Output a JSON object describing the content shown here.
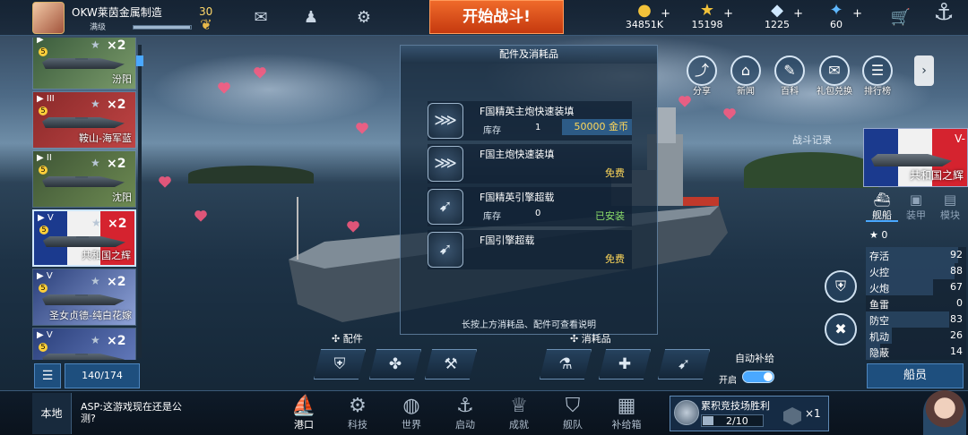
{
  "player": {
    "name": "OKW莱茵金属制造",
    "rank": "满级",
    "level": "30",
    "xp_fraction": 0.98
  },
  "start_battle": "开始战斗!",
  "resources": [
    {
      "icon": "gold-coin-icon",
      "symbol": "●",
      "value": "34851K",
      "color": "#f2c23a"
    },
    {
      "icon": "star-icon",
      "symbol": "★",
      "value": "15198",
      "color": "#f2c23a"
    },
    {
      "icon": "diamond-icon",
      "symbol": "◆",
      "value": "1225",
      "color": "#cfe8ff"
    },
    {
      "icon": "gem-icon",
      "symbol": "✦",
      "value": "60",
      "color": "#5fb8ff"
    }
  ],
  "fleet": [
    {
      "name": "汾阳",
      "tier": "",
      "mult": "×2",
      "bg": "linear-gradient(135deg,#3a5b3c,#7a9a6a)"
    },
    {
      "name": "鞍山-海军蓝",
      "tier": "III",
      "mult": "×2",
      "bg": "linear-gradient(135deg,#8a2a2a,#c04444)"
    },
    {
      "name": "沈阳",
      "tier": "II",
      "mult": "×2",
      "bg": "linear-gradient(135deg,#3f5636,#6d8a52)"
    },
    {
      "name": "共和国之辉",
      "tier": "V",
      "mult": "×2",
      "bg": "linear-gradient(90deg,#1b3a8e 0 33%,#f1f1f1 33% 66%,#d5232f 66%)"
    },
    {
      "name": "圣女贞德-纯白花嫁",
      "tier": "V",
      "mult": "×2",
      "bg": "linear-gradient(135deg,#2a3f7a,#8fa3d8)"
    },
    {
      "name": "",
      "tier": "V",
      "mult": "×2",
      "bg": "linear-gradient(135deg,#2a3f7a,#6b82c4)"
    }
  ],
  "fleet_count": "140/174",
  "top_menu": [
    {
      "label": "分享",
      "icon": "share-icon",
      "symbol": "⤴"
    },
    {
      "label": "新闻",
      "icon": "news-icon",
      "symbol": "⌂"
    },
    {
      "label": "百科",
      "icon": "encyclopedia-icon",
      "symbol": "✎"
    },
    {
      "label": "礼包兑换",
      "icon": "gift-icon",
      "symbol": "✉"
    },
    {
      "label": "排行榜",
      "icon": "ranking-icon",
      "symbol": "☰"
    }
  ],
  "battle_log": "战斗记录",
  "ship_card": {
    "name": "共和国之辉",
    "tier": "V-"
  },
  "right_tabs": [
    {
      "label": "舰船",
      "icon": "ship-icon",
      "symbol": "⛴"
    },
    {
      "label": "装甲",
      "icon": "armor-icon",
      "symbol": "▣"
    },
    {
      "label": "模块",
      "icon": "module-icon",
      "symbol": "▤"
    }
  ],
  "stars_count": "0",
  "stats": [
    {
      "name": "存活",
      "value": 92
    },
    {
      "name": "火控",
      "value": 88
    },
    {
      "name": "火炮",
      "value": 67
    },
    {
      "name": "鱼雷",
      "value": 0
    },
    {
      "name": "防空",
      "value": 83
    },
    {
      "name": "机动",
      "value": 26
    },
    {
      "name": "隐蔽",
      "value": 14
    }
  ],
  "crew_button": "船员",
  "modal": {
    "title": "配件及消耗品",
    "stock_label": "库存",
    "items": [
      {
        "name": "F国精英主炮快速装填",
        "qty": "1",
        "price": "50000 金币",
        "status": "",
        "icon": "reload-elite-icon",
        "symbol": "⋙"
      },
      {
        "name": "F国主炮快速装填",
        "qty": "",
        "price": "",
        "status": "免费",
        "icon": "reload-icon",
        "symbol": "⋙"
      },
      {
        "name": "F国精英引擎超载",
        "qty": "0",
        "price": "",
        "status": "已安装",
        "icon": "engine-elite-icon",
        "symbol": "➹"
      },
      {
        "name": "F国引擎超载",
        "qty": "",
        "price": "",
        "status": "免费",
        "icon": "engine-icon",
        "symbol": "➹"
      }
    ],
    "hint": "长按上方消耗品、配件可查看说明"
  },
  "slots": {
    "parts_label": "配件",
    "consumables_label": "消耗品"
  },
  "auto_supply": {
    "label": "自动补给",
    "state": "开启"
  },
  "chat": {
    "tab": "本地",
    "message": "ASP:这游戏现在还是公测?"
  },
  "nav": [
    {
      "label": "港口",
      "icon": "port-icon",
      "symbol": "⛵"
    },
    {
      "label": "科技",
      "icon": "tech-icon",
      "symbol": "⚙"
    },
    {
      "label": "世界",
      "icon": "world-icon",
      "symbol": "◍"
    },
    {
      "label": "启动",
      "icon": "launch-icon",
      "symbol": "⚓"
    },
    {
      "label": "成就",
      "icon": "achievement-icon",
      "symbol": "♕"
    },
    {
      "label": "舰队",
      "icon": "fleet-icon",
      "symbol": "⛉"
    },
    {
      "label": "补给箱",
      "icon": "supply-box-icon",
      "symbol": "▦"
    }
  ],
  "arena": {
    "title": "累积竞技场胜利",
    "progress": "2/10",
    "reward_mult": "×1"
  }
}
